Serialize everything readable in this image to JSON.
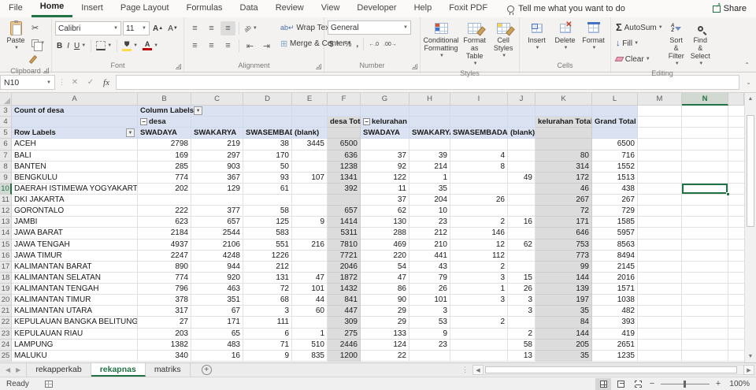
{
  "menubar": {
    "tabs": [
      "File",
      "Home",
      "Insert",
      "Page Layout",
      "Formulas",
      "Data",
      "Review",
      "View",
      "Developer",
      "Help",
      "Foxit PDF"
    ],
    "active_tab": "Home",
    "tell_me": "Tell me what you want to do",
    "share_label": "Share"
  },
  "ribbon": {
    "clipboard": {
      "group_label": "Clipboard",
      "paste_label": "Paste"
    },
    "font": {
      "group_label": "Font",
      "font_name": "Calibri",
      "font_size": "11",
      "bold": "B",
      "italic": "I",
      "underline": "U"
    },
    "alignment": {
      "group_label": "Alignment",
      "wrap_text_label": "Wrap Text",
      "merge_center_label": "Merge & Center"
    },
    "number": {
      "group_label": "Number",
      "format_value": "General",
      "currency": "$",
      "percent": "%",
      "comma": ","
    },
    "styles": {
      "group_label": "Styles",
      "conditional_label": "Conditional Formatting",
      "format_table_label": "Format as Table",
      "cell_styles_label": "Cell Styles"
    },
    "cells": {
      "group_label": "Cells",
      "insert_label": "Insert",
      "delete_label": "Delete",
      "format_label": "Format"
    },
    "editing": {
      "group_label": "Editing",
      "autosum_label": "AutoSum",
      "fill_label": "Fill",
      "clear_label": "Clear",
      "sort_label": "Sort & Filter",
      "find_label": "Find & Select"
    }
  },
  "formula_bar": {
    "name_box": "N10",
    "formula_value": ""
  },
  "grid": {
    "visible_columns": [
      "A",
      "B",
      "C",
      "D",
      "E",
      "F",
      "G",
      "H",
      "I",
      "J",
      "K",
      "L",
      "M",
      "N",
      "O"
    ],
    "first_visible_row": 3,
    "last_visible_row": 25,
    "selected_cell": "N10",
    "selected_column": "N",
    "selected_row": 10
  },
  "pivot": {
    "title_cell": "Count of desa",
    "column_labels": "Column Labels",
    "row_labels": "Row Labels",
    "group1": "desa",
    "group1_total": "desa Total",
    "group2": "kelurahan",
    "group2_total": "kelurahan Total",
    "grand_total": "Grand Total",
    "categories": [
      "SWADAYA",
      "SWAKARYA",
      "SWASEMBADA",
      "(blank)"
    ],
    "rows": [
      {
        "row": 6,
        "label": "ACEH",
        "desa": [
          "2798",
          "219",
          "38",
          "3445"
        ],
        "desa_total": "6500",
        "kelurahan": [
          "",
          "",
          "",
          ""
        ],
        "kelurahan_total": "",
        "grand": "6500"
      },
      {
        "row": 7,
        "label": "BALI",
        "desa": [
          "169",
          "297",
          "170",
          ""
        ],
        "desa_total": "636",
        "kelurahan": [
          "37",
          "39",
          "4",
          ""
        ],
        "kelurahan_total": "80",
        "grand": "716"
      },
      {
        "row": 8,
        "label": "BANTEN",
        "desa": [
          "285",
          "903",
          "50",
          ""
        ],
        "desa_total": "1238",
        "kelurahan": [
          "92",
          "214",
          "8",
          ""
        ],
        "kelurahan_total": "314",
        "grand": "1552"
      },
      {
        "row": 9,
        "label": "BENGKULU",
        "desa": [
          "774",
          "367",
          "93",
          "107"
        ],
        "desa_total": "1341",
        "kelurahan": [
          "122",
          "1",
          "",
          "49"
        ],
        "kelurahan_total": "172",
        "grand": "1513"
      },
      {
        "row": 10,
        "label": "DAERAH ISTIMEWA YOGYAKARTA",
        "desa": [
          "202",
          "129",
          "61",
          ""
        ],
        "desa_total": "392",
        "kelurahan": [
          "11",
          "35",
          "",
          ""
        ],
        "kelurahan_total": "46",
        "grand": "438"
      },
      {
        "row": 11,
        "label": "DKI JAKARTA",
        "desa": [
          "",
          "",
          "",
          ""
        ],
        "desa_total": "",
        "kelurahan": [
          "37",
          "204",
          "26",
          ""
        ],
        "kelurahan_total": "267",
        "grand": "267"
      },
      {
        "row": 12,
        "label": "GORONTALO",
        "desa": [
          "222",
          "377",
          "58",
          ""
        ],
        "desa_total": "657",
        "kelurahan": [
          "62",
          "10",
          "",
          ""
        ],
        "kelurahan_total": "72",
        "grand": "729"
      },
      {
        "row": 13,
        "label": "JAMBI",
        "desa": [
          "623",
          "657",
          "125",
          "9"
        ],
        "desa_total": "1414",
        "kelurahan": [
          "130",
          "23",
          "2",
          "16"
        ],
        "kelurahan_total": "171",
        "grand": "1585"
      },
      {
        "row": 14,
        "label": "JAWA BARAT",
        "desa": [
          "2184",
          "2544",
          "583",
          ""
        ],
        "desa_total": "5311",
        "kelurahan": [
          "288",
          "212",
          "146",
          ""
        ],
        "kelurahan_total": "646",
        "grand": "5957"
      },
      {
        "row": 15,
        "label": "JAWA TENGAH",
        "desa": [
          "4937",
          "2106",
          "551",
          "216"
        ],
        "desa_total": "7810",
        "kelurahan": [
          "469",
          "210",
          "12",
          "62"
        ],
        "kelurahan_total": "753",
        "grand": "8563"
      },
      {
        "row": 16,
        "label": "JAWA TIMUR",
        "desa": [
          "2247",
          "4248",
          "1226",
          ""
        ],
        "desa_total": "7721",
        "kelurahan": [
          "220",
          "441",
          "112",
          ""
        ],
        "kelurahan_total": "773",
        "grand": "8494"
      },
      {
        "row": 17,
        "label": "KALIMANTAN BARAT",
        "desa": [
          "890",
          "944",
          "212",
          ""
        ],
        "desa_total": "2046",
        "kelurahan": [
          "54",
          "43",
          "2",
          ""
        ],
        "kelurahan_total": "99",
        "grand": "2145"
      },
      {
        "row": 18,
        "label": "KALIMANTAN SELATAN",
        "desa": [
          "774",
          "920",
          "131",
          "47"
        ],
        "desa_total": "1872",
        "kelurahan": [
          "47",
          "79",
          "3",
          "15"
        ],
        "kelurahan_total": "144",
        "grand": "2016"
      },
      {
        "row": 19,
        "label": "KALIMANTAN TENGAH",
        "desa": [
          "796",
          "463",
          "72",
          "101"
        ],
        "desa_total": "1432",
        "kelurahan": [
          "86",
          "26",
          "1",
          "26"
        ],
        "kelurahan_total": "139",
        "grand": "1571"
      },
      {
        "row": 20,
        "label": "KALIMANTAN TIMUR",
        "desa": [
          "378",
          "351",
          "68",
          "44"
        ],
        "desa_total": "841",
        "kelurahan": [
          "90",
          "101",
          "3",
          "3"
        ],
        "kelurahan_total": "197",
        "grand": "1038"
      },
      {
        "row": 21,
        "label": "KALIMANTAN UTARA",
        "desa": [
          "317",
          "67",
          "3",
          "60"
        ],
        "desa_total": "447",
        "kelurahan": [
          "29",
          "3",
          "",
          "3"
        ],
        "kelurahan_total": "35",
        "grand": "482"
      },
      {
        "row": 22,
        "label": "KEPULAUAN BANGKA BELITUNG",
        "desa": [
          "27",
          "171",
          "111",
          ""
        ],
        "desa_total": "309",
        "kelurahan": [
          "29",
          "53",
          "2",
          ""
        ],
        "kelurahan_total": "84",
        "grand": "393"
      },
      {
        "row": 23,
        "label": "KEPULAUAN RIAU",
        "desa": [
          "203",
          "65",
          "6",
          "1"
        ],
        "desa_total": "275",
        "kelurahan": [
          "133",
          "9",
          "",
          "2"
        ],
        "kelurahan_total": "144",
        "grand": "419"
      },
      {
        "row": 24,
        "label": "LAMPUNG",
        "desa": [
          "1382",
          "483",
          "71",
          "510"
        ],
        "desa_total": "2446",
        "kelurahan": [
          "124",
          "23",
          "",
          "58"
        ],
        "kelurahan_total": "205",
        "grand": "2651"
      },
      {
        "row": 25,
        "label": "MALUKU",
        "desa": [
          "340",
          "16",
          "9",
          "835"
        ],
        "desa_total": "1200",
        "kelurahan": [
          "22",
          "",
          "",
          "13"
        ],
        "kelurahan_total": "35",
        "grand": "1235"
      }
    ]
  },
  "sheetbar": {
    "tabs": [
      "rekapperkab",
      "rekapnas",
      "matriks"
    ],
    "active_tab": "rekapnas"
  },
  "statusbar": {
    "mode": "Ready",
    "zoom_level": "100%"
  },
  "colors": {
    "accent_green": "#217346",
    "pivot_header_blue": "#DBE3F2",
    "total_column_gray": "#DCDCDC",
    "fill_yellow": "#FFD94A",
    "font_red": "#C00000"
  },
  "icons": {
    "tell_me": "lightbulb-icon",
    "share": "share-icon",
    "cut": "scissors-icon",
    "autosum": "sigma-icon",
    "find": "magnifier-icon"
  }
}
